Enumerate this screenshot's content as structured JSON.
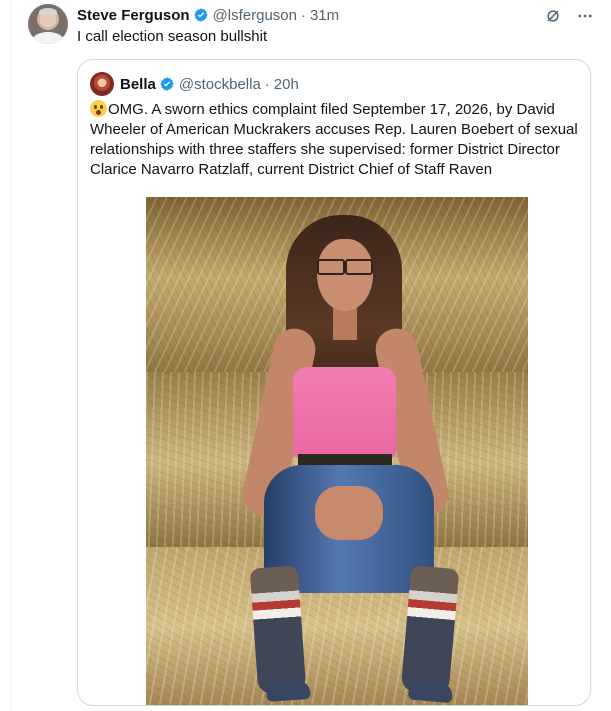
{
  "post": {
    "author_name": "Steve Ferguson",
    "handle": "@lsferguson",
    "separator": "·",
    "time": "31m",
    "text": "I call election season bullshit",
    "actions": {
      "grok_icon": "slashed-circle-icon",
      "more_icon": "more-icon"
    }
  },
  "quote": {
    "author_name": "Bella",
    "handle": "@stockbella",
    "separator": "·",
    "time": "20h",
    "text": "OMG.  A sworn ethics complaint filed September 17, 2026, by David Wheeler of American Muckrakers accuses Rep. Lauren Boebert of sexual relationships with three staffers she supervised:  former District Director Clarice Navarro Ratzlaff, current District Chief of Staff Raven",
    "media_description": "photo of a woman seated on hay bales"
  },
  "colors": {
    "verified": "#1d9bf0",
    "secondary_text": "#536471",
    "border": "#cfd9de"
  }
}
